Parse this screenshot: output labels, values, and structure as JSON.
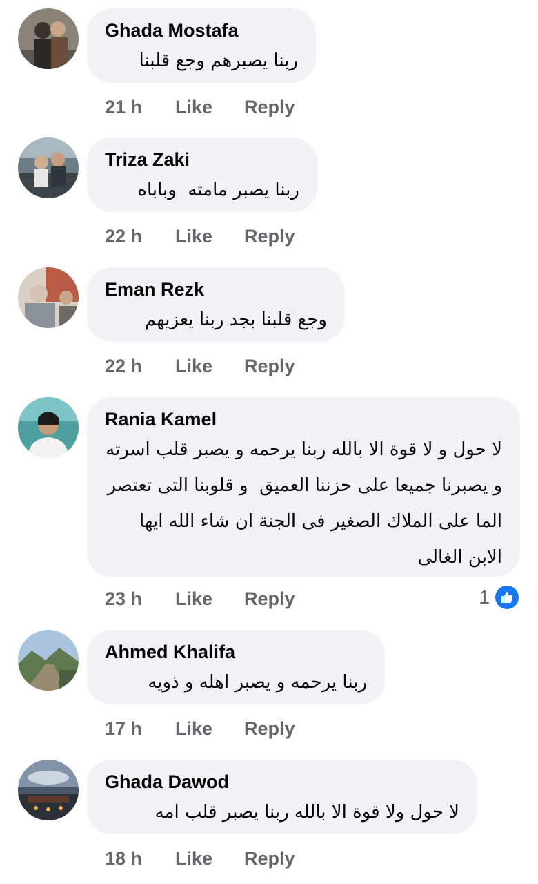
{
  "actions": {
    "like_label": "Like",
    "reply_label": "Reply"
  },
  "colors": {
    "bubble": "#f0f2f5",
    "meta_text": "#65676b",
    "like_blue": "#1877f2"
  },
  "comments": [
    {
      "name": "Ghada Mostafa",
      "text": "ربنا يصبرهم وجع قلبنا",
      "time": "21 h"
    },
    {
      "name": "Triza Zaki",
      "text": "ربنا يصبر مامته  وباباه",
      "time": "22 h"
    },
    {
      "name": "Eman Rezk",
      "text": "وجع قلبنا بجد ربنا يعزيهم",
      "time": "22 h"
    },
    {
      "name": "Rania Kamel",
      "text": "لا حول و لا قوة الا بالله ربنا يرحمه و يصبر قلب اسرته و يصبرنا جميعا على حزننا العميق  و قلوبنا التى تعتصر الما على الملاك الصغير فى الجنة ان شاء الله ايها الابن الغالى",
      "time": "23 h",
      "reaction_count": "1",
      "reaction_icon": "thumbs-up-icon"
    },
    {
      "name": "Ahmed Khalifa",
      "text": "ربنا يرحمه و يصبر اهله و ذويه",
      "time": "17 h"
    },
    {
      "name": "Ghada Dawod",
      "text": "لا حول ولا قوة الا بالله ربنا يصبر قلب امه",
      "time": "18 h"
    }
  ]
}
